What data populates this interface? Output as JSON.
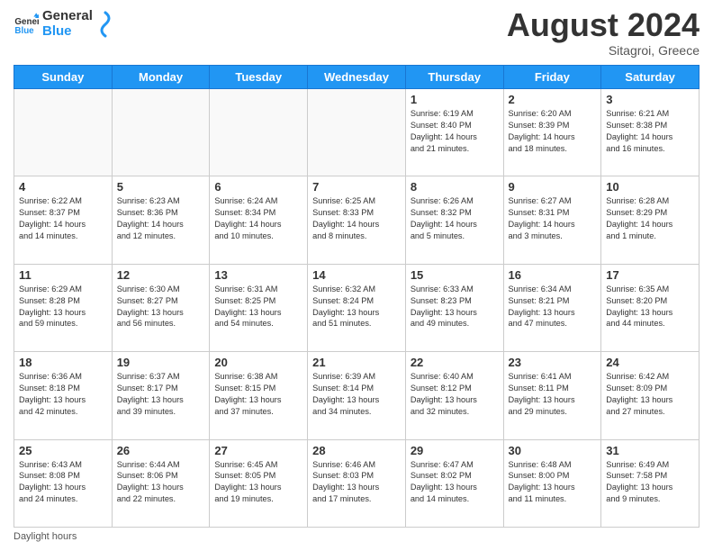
{
  "header": {
    "logo_general": "General",
    "logo_blue": "Blue",
    "month_title": "August 2024",
    "subtitle": "Sitagroi, Greece"
  },
  "footer": {
    "note": "Daylight hours"
  },
  "days_of_week": [
    "Sunday",
    "Monday",
    "Tuesday",
    "Wednesday",
    "Thursday",
    "Friday",
    "Saturday"
  ],
  "weeks": [
    [
      {
        "day": "",
        "info": ""
      },
      {
        "day": "",
        "info": ""
      },
      {
        "day": "",
        "info": ""
      },
      {
        "day": "",
        "info": ""
      },
      {
        "day": "1",
        "info": "Sunrise: 6:19 AM\nSunset: 8:40 PM\nDaylight: 14 hours\nand 21 minutes."
      },
      {
        "day": "2",
        "info": "Sunrise: 6:20 AM\nSunset: 8:39 PM\nDaylight: 14 hours\nand 18 minutes."
      },
      {
        "day": "3",
        "info": "Sunrise: 6:21 AM\nSunset: 8:38 PM\nDaylight: 14 hours\nand 16 minutes."
      }
    ],
    [
      {
        "day": "4",
        "info": "Sunrise: 6:22 AM\nSunset: 8:37 PM\nDaylight: 14 hours\nand 14 minutes."
      },
      {
        "day": "5",
        "info": "Sunrise: 6:23 AM\nSunset: 8:36 PM\nDaylight: 14 hours\nand 12 minutes."
      },
      {
        "day": "6",
        "info": "Sunrise: 6:24 AM\nSunset: 8:34 PM\nDaylight: 14 hours\nand 10 minutes."
      },
      {
        "day": "7",
        "info": "Sunrise: 6:25 AM\nSunset: 8:33 PM\nDaylight: 14 hours\nand 8 minutes."
      },
      {
        "day": "8",
        "info": "Sunrise: 6:26 AM\nSunset: 8:32 PM\nDaylight: 14 hours\nand 5 minutes."
      },
      {
        "day": "9",
        "info": "Sunrise: 6:27 AM\nSunset: 8:31 PM\nDaylight: 14 hours\nand 3 minutes."
      },
      {
        "day": "10",
        "info": "Sunrise: 6:28 AM\nSunset: 8:29 PM\nDaylight: 14 hours\nand 1 minute."
      }
    ],
    [
      {
        "day": "11",
        "info": "Sunrise: 6:29 AM\nSunset: 8:28 PM\nDaylight: 13 hours\nand 59 minutes."
      },
      {
        "day": "12",
        "info": "Sunrise: 6:30 AM\nSunset: 8:27 PM\nDaylight: 13 hours\nand 56 minutes."
      },
      {
        "day": "13",
        "info": "Sunrise: 6:31 AM\nSunset: 8:25 PM\nDaylight: 13 hours\nand 54 minutes."
      },
      {
        "day": "14",
        "info": "Sunrise: 6:32 AM\nSunset: 8:24 PM\nDaylight: 13 hours\nand 51 minutes."
      },
      {
        "day": "15",
        "info": "Sunrise: 6:33 AM\nSunset: 8:23 PM\nDaylight: 13 hours\nand 49 minutes."
      },
      {
        "day": "16",
        "info": "Sunrise: 6:34 AM\nSunset: 8:21 PM\nDaylight: 13 hours\nand 47 minutes."
      },
      {
        "day": "17",
        "info": "Sunrise: 6:35 AM\nSunset: 8:20 PM\nDaylight: 13 hours\nand 44 minutes."
      }
    ],
    [
      {
        "day": "18",
        "info": "Sunrise: 6:36 AM\nSunset: 8:18 PM\nDaylight: 13 hours\nand 42 minutes."
      },
      {
        "day": "19",
        "info": "Sunrise: 6:37 AM\nSunset: 8:17 PM\nDaylight: 13 hours\nand 39 minutes."
      },
      {
        "day": "20",
        "info": "Sunrise: 6:38 AM\nSunset: 8:15 PM\nDaylight: 13 hours\nand 37 minutes."
      },
      {
        "day": "21",
        "info": "Sunrise: 6:39 AM\nSunset: 8:14 PM\nDaylight: 13 hours\nand 34 minutes."
      },
      {
        "day": "22",
        "info": "Sunrise: 6:40 AM\nSunset: 8:12 PM\nDaylight: 13 hours\nand 32 minutes."
      },
      {
        "day": "23",
        "info": "Sunrise: 6:41 AM\nSunset: 8:11 PM\nDaylight: 13 hours\nand 29 minutes."
      },
      {
        "day": "24",
        "info": "Sunrise: 6:42 AM\nSunset: 8:09 PM\nDaylight: 13 hours\nand 27 minutes."
      }
    ],
    [
      {
        "day": "25",
        "info": "Sunrise: 6:43 AM\nSunset: 8:08 PM\nDaylight: 13 hours\nand 24 minutes."
      },
      {
        "day": "26",
        "info": "Sunrise: 6:44 AM\nSunset: 8:06 PM\nDaylight: 13 hours\nand 22 minutes."
      },
      {
        "day": "27",
        "info": "Sunrise: 6:45 AM\nSunset: 8:05 PM\nDaylight: 13 hours\nand 19 minutes."
      },
      {
        "day": "28",
        "info": "Sunrise: 6:46 AM\nSunset: 8:03 PM\nDaylight: 13 hours\nand 17 minutes."
      },
      {
        "day": "29",
        "info": "Sunrise: 6:47 AM\nSunset: 8:02 PM\nDaylight: 13 hours\nand 14 minutes."
      },
      {
        "day": "30",
        "info": "Sunrise: 6:48 AM\nSunset: 8:00 PM\nDaylight: 13 hours\nand 11 minutes."
      },
      {
        "day": "31",
        "info": "Sunrise: 6:49 AM\nSunset: 7:58 PM\nDaylight: 13 hours\nand 9 minutes."
      }
    ]
  ]
}
